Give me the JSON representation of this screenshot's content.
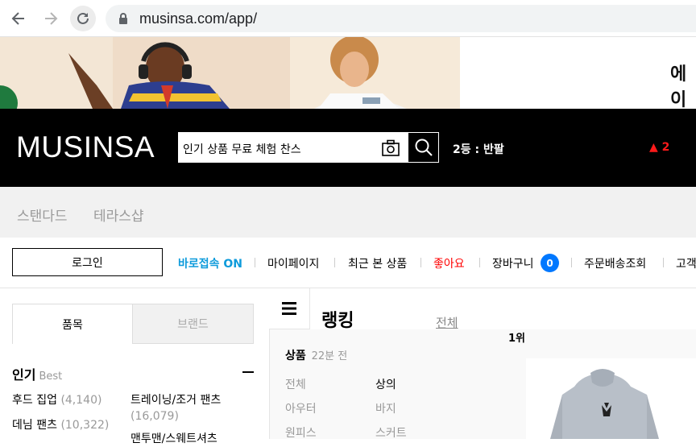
{
  "browser": {
    "url": "musinsa.com/app/"
  },
  "banner": {
    "text": "에이"
  },
  "header": {
    "logo": "MUSINSA",
    "search_value": "인기 상품 무료 체험 찬스",
    "rank_text": "2등 : 반팔",
    "rank_change": "▲ 2",
    "rank_change_color": "#ff1a1a"
  },
  "store_tabs": [
    "스탠다드",
    "테라스샵"
  ],
  "member_bar": {
    "login": "로그인",
    "quick_access": "바로접속 ON",
    "mypage": "마이페이지",
    "recent": "최근 본 상품",
    "likes": "좋아요",
    "cart": "장바구니",
    "cart_count": "0",
    "orders": "주문배송조회",
    "support": "고객"
  },
  "left_panel": {
    "tabs": [
      "품목",
      "브랜드"
    ],
    "heading": "인기",
    "heading_sub": "Best",
    "items": [
      {
        "name": "후드 집업",
        "count": "(4,140)"
      },
      {
        "name": "트레이닝/조거 팬츠",
        "count": "(16,079)"
      },
      {
        "name": "데님 팬츠",
        "count": "(10,322)"
      },
      {
        "name": "맨투맨/스웨트셔츠",
        "count": ""
      }
    ]
  },
  "ranking": {
    "title": "랭킹",
    "all": "전체",
    "first": "1위",
    "section": "상품",
    "section_sub": "22분 전",
    "categories": [
      "전체",
      "상의",
      "아우터",
      "바지",
      "원피스",
      "스커트"
    ]
  },
  "colors": {
    "header_bg": "#000000",
    "accent_blue": "#0e9bdb",
    "badge_blue": "#0078ff",
    "likes_red": "#ff0000"
  }
}
